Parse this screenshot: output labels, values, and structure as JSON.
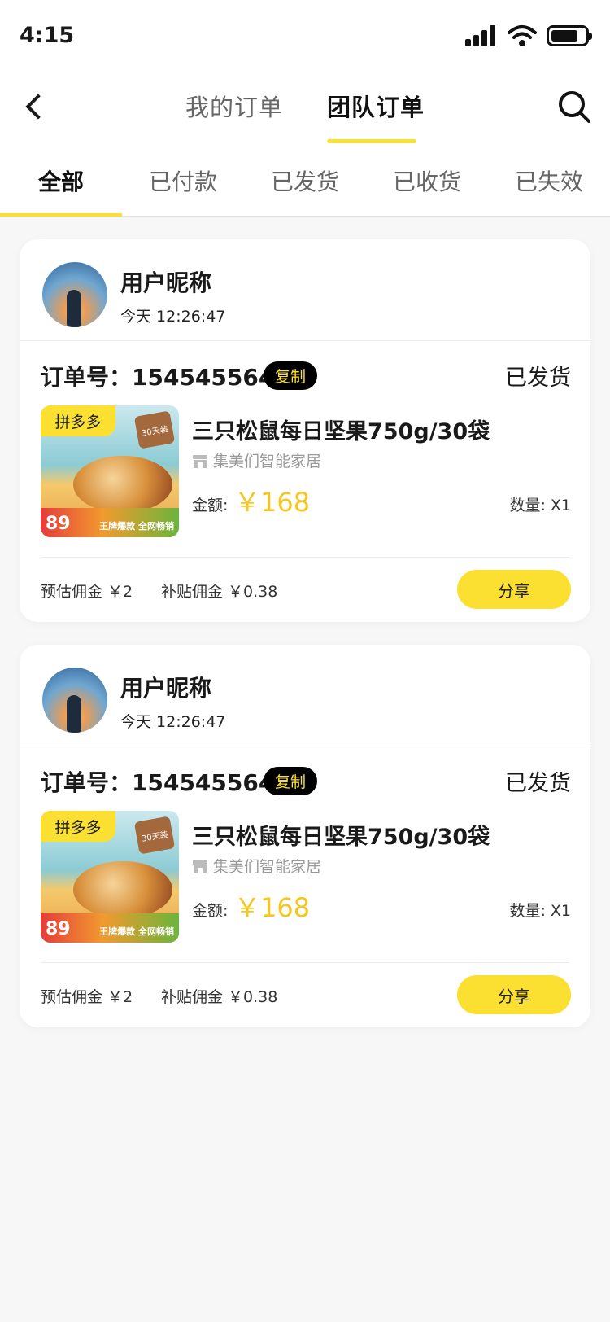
{
  "status_bar": {
    "time": "4:15"
  },
  "nav": {
    "tab_my_orders": "我的订单",
    "tab_team_orders": "团队订单"
  },
  "filters": [
    "全部",
    "已付款",
    "已发货",
    "已收货",
    "已失效"
  ],
  "orders": [
    {
      "user_name": "用户昵称",
      "time": "今天   12:26:47",
      "order_label": "订单号：154545564",
      "copy_label": "复制",
      "status": "已发货",
      "image_tag": "拼多多",
      "image_price": "89",
      "image_slogan": "王牌爆款 全网畅销",
      "image_badge": "30天装",
      "product_title": "三只松鼠每日坚果750g/30袋",
      "store": "集美们智能家居",
      "amount_label": "金额:",
      "amount_value": "￥168",
      "quantity": "数量:  X1",
      "commission": "预估佣金  ￥2",
      "subsidy": "补贴佣金  ￥0.38",
      "share_label": "分享"
    },
    {
      "user_name": "用户昵称",
      "time": "今天   12:26:47",
      "order_label": "订单号：154545564",
      "copy_label": "复制",
      "status": "已发货",
      "image_tag": "拼多多",
      "image_price": "89",
      "image_slogan": "王牌爆款 全网畅销",
      "image_badge": "30天装",
      "product_title": "三只松鼠每日坚果750g/30袋",
      "store": "集美们智能家居",
      "amount_label": "金额:",
      "amount_value": "￥168",
      "quantity": "数量:  X1",
      "commission": "预估佣金  ￥2",
      "subsidy": "补贴佣金  ￥0.38",
      "share_label": "分享"
    }
  ],
  "colors": {
    "accent": "#fbe032",
    "price": "#f7c61e"
  },
  "icons": [
    "signal-icon",
    "wifi-icon",
    "battery-icon",
    "back-icon",
    "search-icon",
    "store-icon"
  ]
}
